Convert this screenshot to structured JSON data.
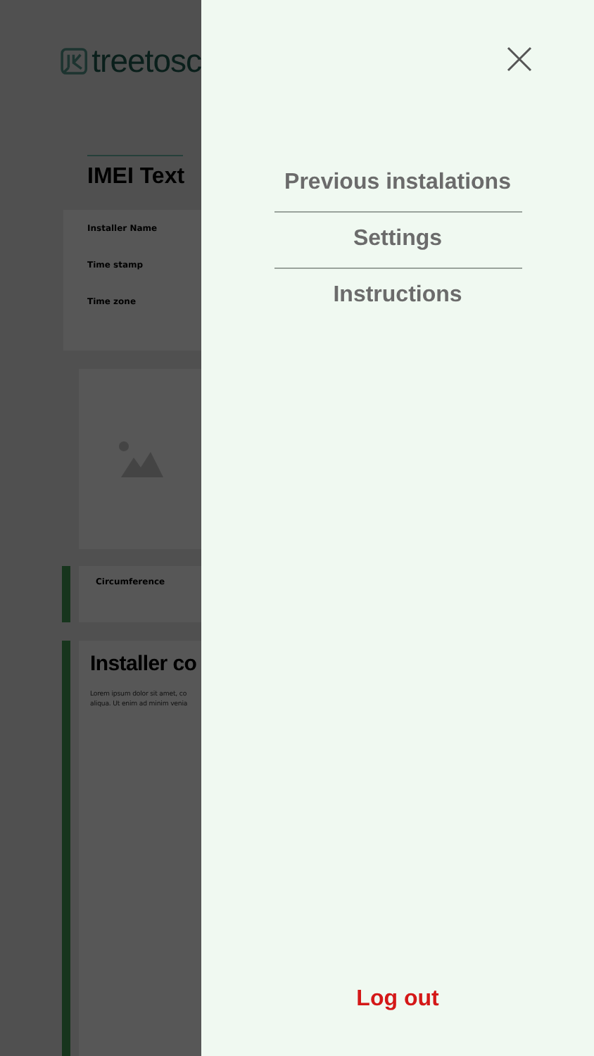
{
  "background": {
    "logo": {
      "text": "treetosc"
    },
    "title": "IMEI Text",
    "fields": [
      "Installer Name",
      "Time stamp",
      "Time zone"
    ],
    "measurement": "Circumference",
    "section": {
      "title": "Installer co",
      "text_lines": [
        "Lorem ipsum dolor sit amet, co",
        "aliqua. Ut enim ad minim venia"
      ]
    }
  },
  "menu": {
    "items": [
      {
        "label": "Previous instalations"
      },
      {
        "label": "Settings"
      },
      {
        "label": "Instructions"
      }
    ],
    "logout": "Log out"
  }
}
